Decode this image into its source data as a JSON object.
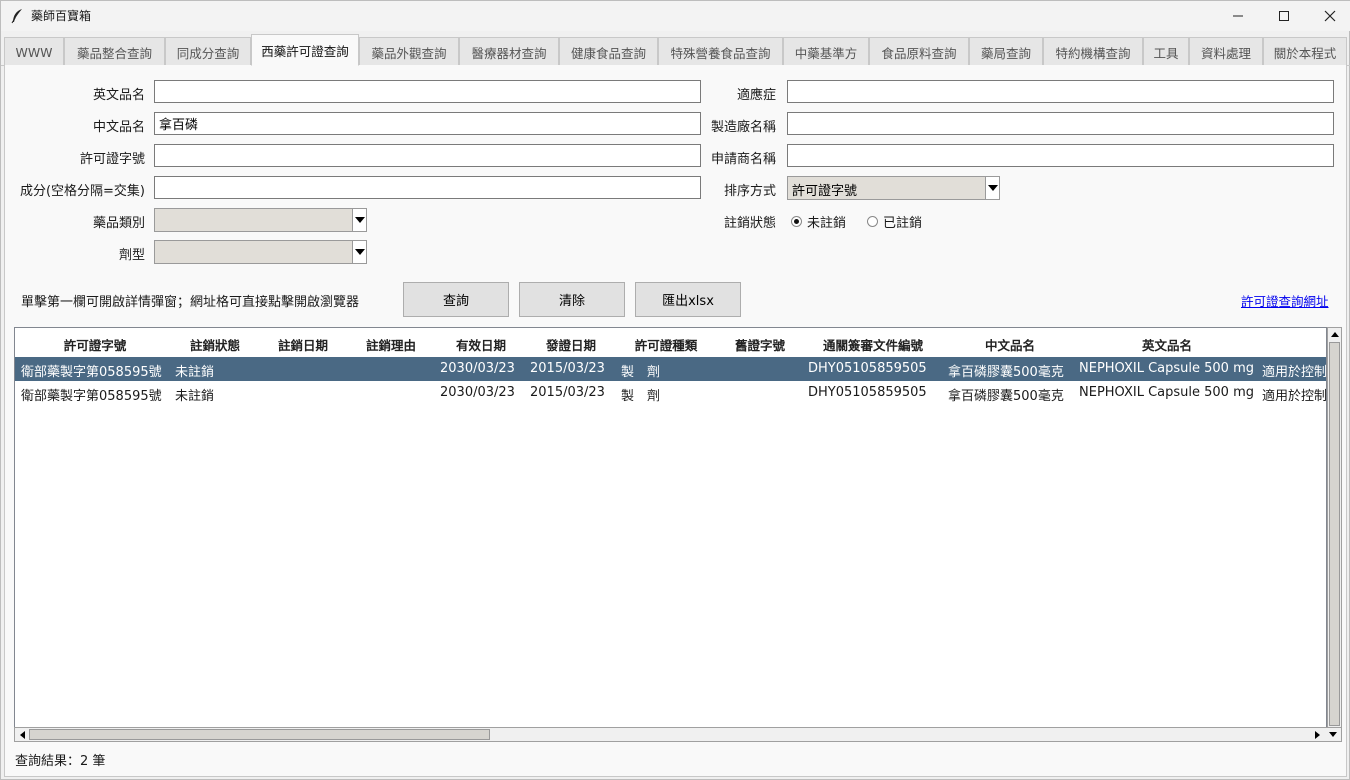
{
  "window": {
    "title": "藥師百寶箱"
  },
  "tabs": [
    "WWW",
    "藥品整合查詢",
    "同成分查詢",
    "西藥許可證查詢",
    "藥品外觀查詢",
    "醫療器材查詢",
    "健康食品查詢",
    "特殊營養食品查詢",
    "中藥基準方",
    "食品原料查詢",
    "藥局查詢",
    "特約機構查詢",
    "工具",
    "資料處理",
    "關於本程式"
  ],
  "active_tab": "西藥許可證查詢",
  "form": {
    "english_name": {
      "label": "英文品名",
      "value": ""
    },
    "chinese_name": {
      "label": "中文品名",
      "value": "拿百磷"
    },
    "license_no": {
      "label": "許可證字號",
      "value": ""
    },
    "ingredient": {
      "label": "成分(空格分隔=交集)",
      "value": ""
    },
    "drug_category": {
      "label": "藥品類別",
      "value": ""
    },
    "dosage_form": {
      "label": "劑型",
      "value": ""
    },
    "indication": {
      "label": "適應症",
      "value": ""
    },
    "manufacturer": {
      "label": "製造廠名稱",
      "value": ""
    },
    "applicant": {
      "label": "申請商名稱",
      "value": ""
    },
    "sort": {
      "label": "排序方式",
      "value": "許可證字號"
    },
    "cancel_status": {
      "label": "註銷狀態",
      "options": [
        "未註銷",
        "已註銷"
      ],
      "selected": "未註銷"
    }
  },
  "actions": {
    "hint": "單擊第一欄可開啟詳情彈窗；網址格可直接點擊開啟瀏覽器",
    "query": "查詢",
    "clear": "清除",
    "export": "匯出xlsx",
    "link": "許可證查詢網址"
  },
  "table": {
    "columns": [
      "許可證字號",
      "註銷狀態",
      "註銷日期",
      "註銷理由",
      "有效日期",
      "發證日期",
      "許可證種類",
      "舊證字號",
      "通關簽審文件編號",
      "中文品名",
      "英文品名"
    ],
    "rows": [
      [
        "衛部藥製字第058595號",
        "未註銷",
        "",
        "",
        "2030/03/23",
        "2015/03/23",
        "製　劑",
        "",
        "DHY05105859505",
        "拿百磷膠囊500毫克",
        "NEPHOXIL Capsule 500 mg",
        "適用於控制"
      ],
      [
        "衛部藥製字第058595號",
        "未註銷",
        "",
        "",
        "2030/03/23",
        "2015/03/23",
        "製　劑",
        "",
        "DHY05105859505",
        "拿百磷膠囊500毫克",
        "NEPHOXIL Capsule 500 mg",
        "適用於控制"
      ]
    ],
    "selected_row": 0
  },
  "status": "查詢結果：2 筆"
}
